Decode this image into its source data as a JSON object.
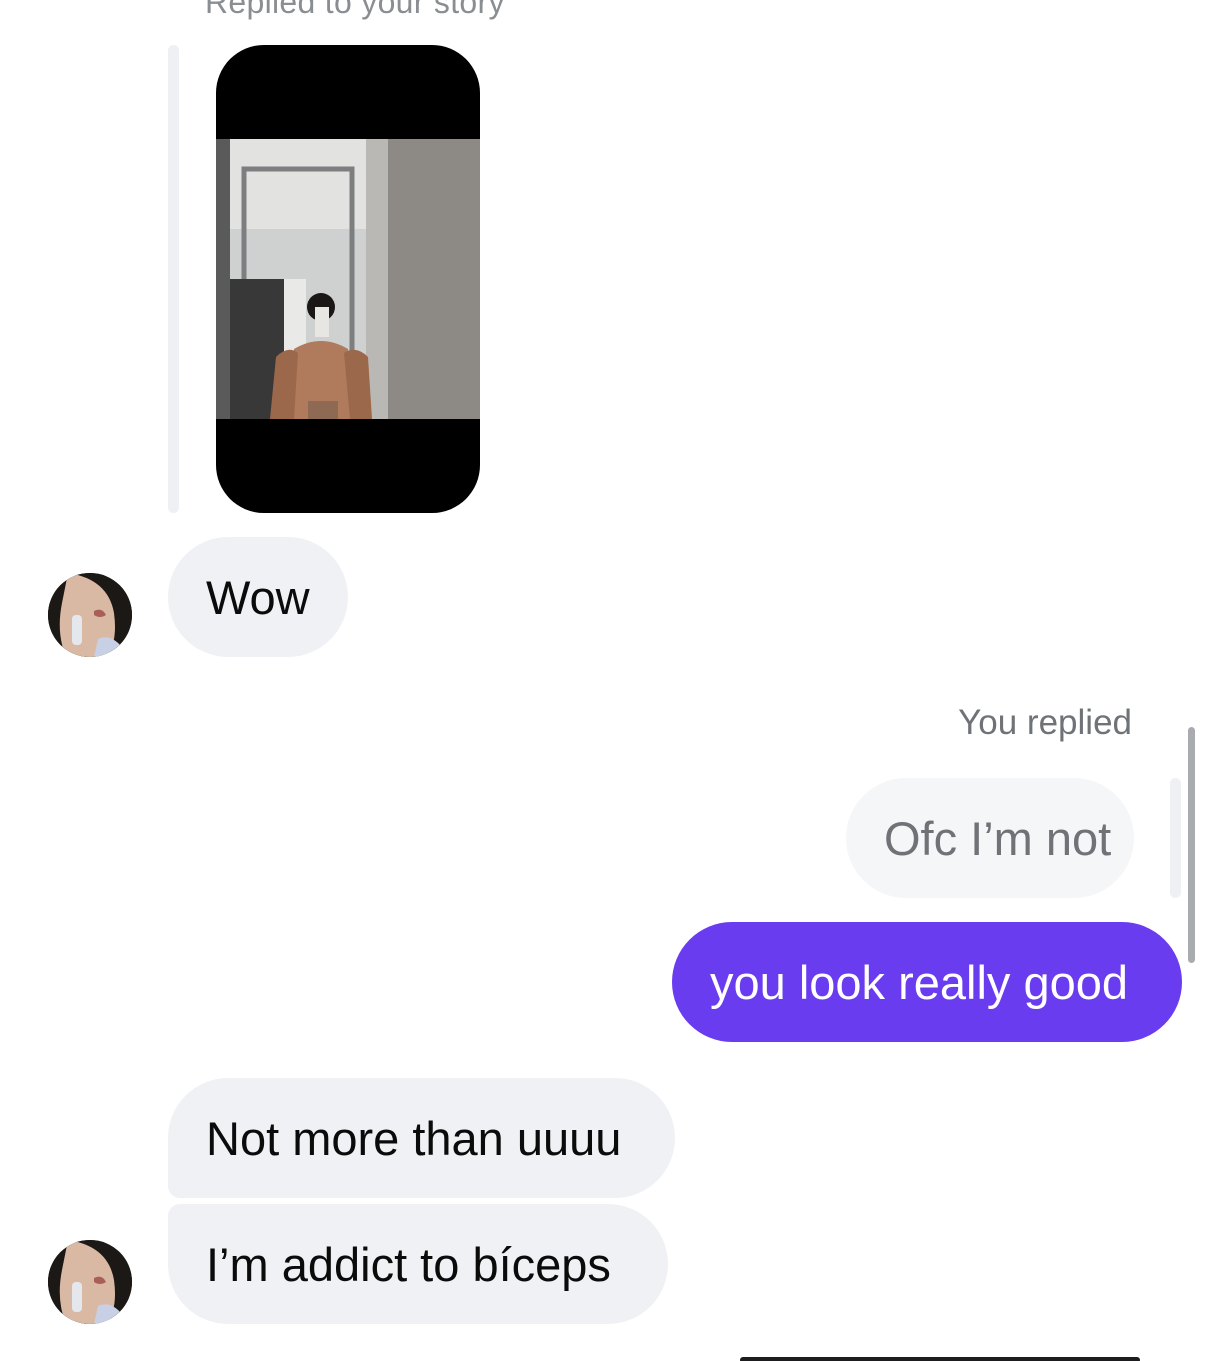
{
  "story_reply": {
    "caption": "Replied to your story"
  },
  "messages": {
    "wow": "Wow",
    "not_more": "Not more than uuuu",
    "addict": "I’m addict to bíceps"
  },
  "reply": {
    "label": "You replied",
    "quoted_text": "Ofc I’m not",
    "sent_text": "you look really good"
  },
  "colors": {
    "outgoing_bubble": "#6a3cf0",
    "incoming_bubble": "#eff1f4",
    "reply_label": "#6f7377"
  },
  "icons": {
    "contact_avatar": "contact-avatar-photo",
    "story_thumbnail": "story-photo-thumbnail"
  }
}
